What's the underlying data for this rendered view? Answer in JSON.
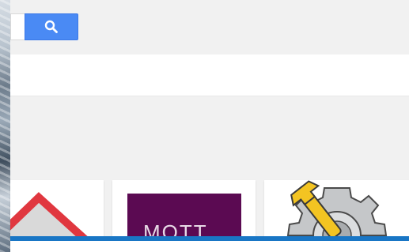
{
  "search": {
    "input_value": "",
    "button_icon": "search-icon"
  },
  "apps": [
    {
      "icon": "red-house-icon",
      "label": ""
    },
    {
      "icon": "mott-logo",
      "label": "MOTT"
    },
    {
      "icon": "gear-with-wrench-icon",
      "label": ""
    }
  ],
  "colors": {
    "search_button": "#4a8af4",
    "progress_line": "#1976c5",
    "mott_tile": "#5b0a52",
    "panel_bg": "#f1f1f1"
  }
}
